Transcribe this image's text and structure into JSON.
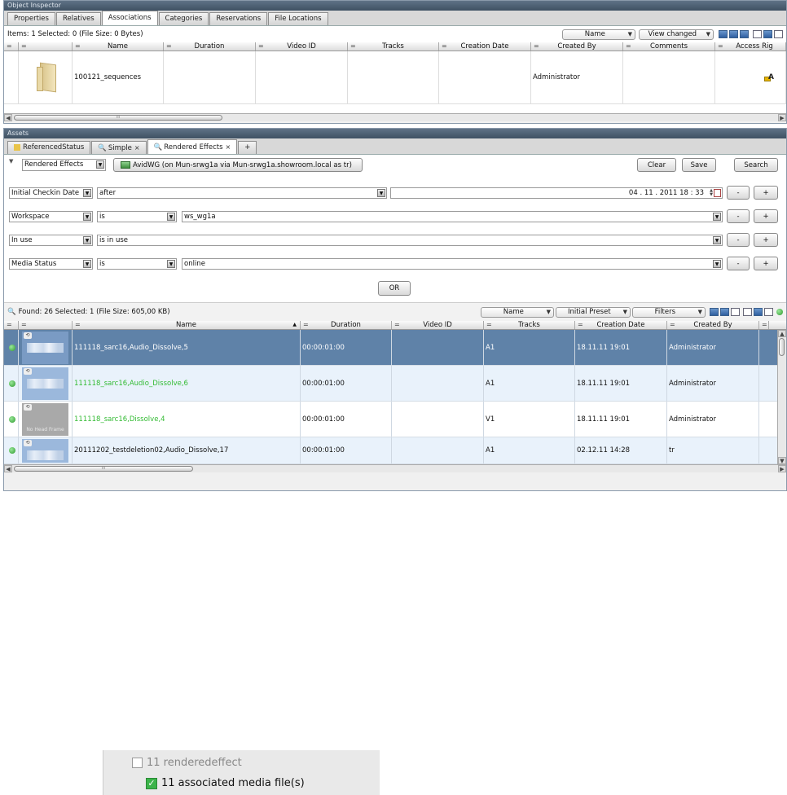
{
  "object_inspector": {
    "title": "Object Inspector",
    "tabs": [
      "Properties",
      "Relatives",
      "Associations",
      "Categories",
      "Reservations",
      "File Locations"
    ],
    "active_tab": "Associations",
    "items_status": "Items: 1 Selected: 0 (File Size: 0 Bytes)",
    "sort_combo": "Name",
    "view_combo": "View changed",
    "columns": [
      "Name",
      "Duration",
      "Video ID",
      "Tracks",
      "Creation Date",
      "Created By",
      "Comments",
      "Access Rig"
    ],
    "rows": [
      {
        "name": "100121_sequences",
        "duration": "",
        "video_id": "",
        "tracks": "",
        "creation_date": "",
        "created_by": "Administrator",
        "comments": "",
        "access_icon": "lock-user-icon"
      }
    ],
    "scroll_mark": "III"
  },
  "assets": {
    "title": "Assets",
    "tabs": [
      {
        "label": "ReferencedStatus",
        "icon": "folder-icon",
        "close": ""
      },
      {
        "label": "Simple",
        "icon": "search-icon",
        "close": "×"
      },
      {
        "label": "Rendered Effects",
        "icon": "search-icon",
        "close": "×"
      },
      {
        "label": "+",
        "icon": "",
        "close": ""
      }
    ],
    "active_tab": "Rendered Effects",
    "query_type": "Rendered Effects",
    "server": "AvidWG (on Mun-srwg1a via Mun-srwg1a.showroom.local as tr)",
    "buttons": {
      "clear": "Clear",
      "save": "Save",
      "search": "Search",
      "or": "OR",
      "minus": "-",
      "plus": "+"
    },
    "filters": [
      {
        "field": "Initial Checkin Date",
        "op": "after",
        "value": "04 . 11 . 2011  18 : 33"
      },
      {
        "field": "Workspace",
        "op": "is",
        "value": "ws_wg1a"
      },
      {
        "field": "In use",
        "op": "is in use",
        "value": ""
      },
      {
        "field": "Media Status",
        "op": "is",
        "value": "online"
      }
    ],
    "found_status": "Found: 26 Selected: 1 (File Size: 605,00 KB)",
    "sort_combo": "Name",
    "preset_combo": "Initial Preset",
    "filters_combo": "Filters",
    "columns": [
      "Name",
      "Duration",
      "Video ID",
      "Tracks",
      "Creation Date",
      "Created By"
    ],
    "rows": [
      {
        "name": "111118_sarc16,Audio_Dissolve,5",
        "duration": "00:00:01:00",
        "video_id": "",
        "tracks": "A1",
        "creation_date": "18.11.11 19:01",
        "created_by": "Administrator",
        "status_color": "#4caf50",
        "name_color": "#ffffff",
        "selected": true,
        "thumb": "audio"
      },
      {
        "name": "111118_sarc16,Audio_Dissolve,6",
        "duration": "00:00:01:00",
        "video_id": "",
        "tracks": "A1",
        "creation_date": "18.11.11 19:01",
        "created_by": "Administrator",
        "status_color": "#4caf50",
        "name_color": "#33bb33",
        "selected": false,
        "thumb": "audio"
      },
      {
        "name": "111118_sarc16,Dissolve,4",
        "duration": "00:00:01:00",
        "video_id": "",
        "tracks": "V1",
        "creation_date": "18.11.11 19:01",
        "created_by": "Administrator",
        "status_color": "#4caf50",
        "name_color": "#33bb33",
        "selected": false,
        "thumb": "nohead",
        "thumb_text": "No Head Frame"
      },
      {
        "name": "20111202_testdeletion02,Audio_Dissolve,17",
        "duration": "00:00:01:00",
        "video_id": "",
        "tracks": "A1",
        "creation_date": "02.12.11 14:28",
        "created_by": "tr",
        "status_color": "#4caf50",
        "name_color": "#111111",
        "selected": false,
        "thumb": "audio"
      }
    ],
    "scroll_mark": "III"
  },
  "legend": {
    "items": [
      {
        "label": "11 renderedeffect",
        "checked": false
      },
      {
        "label": "11 associated media file(s)",
        "checked": true
      }
    ]
  }
}
